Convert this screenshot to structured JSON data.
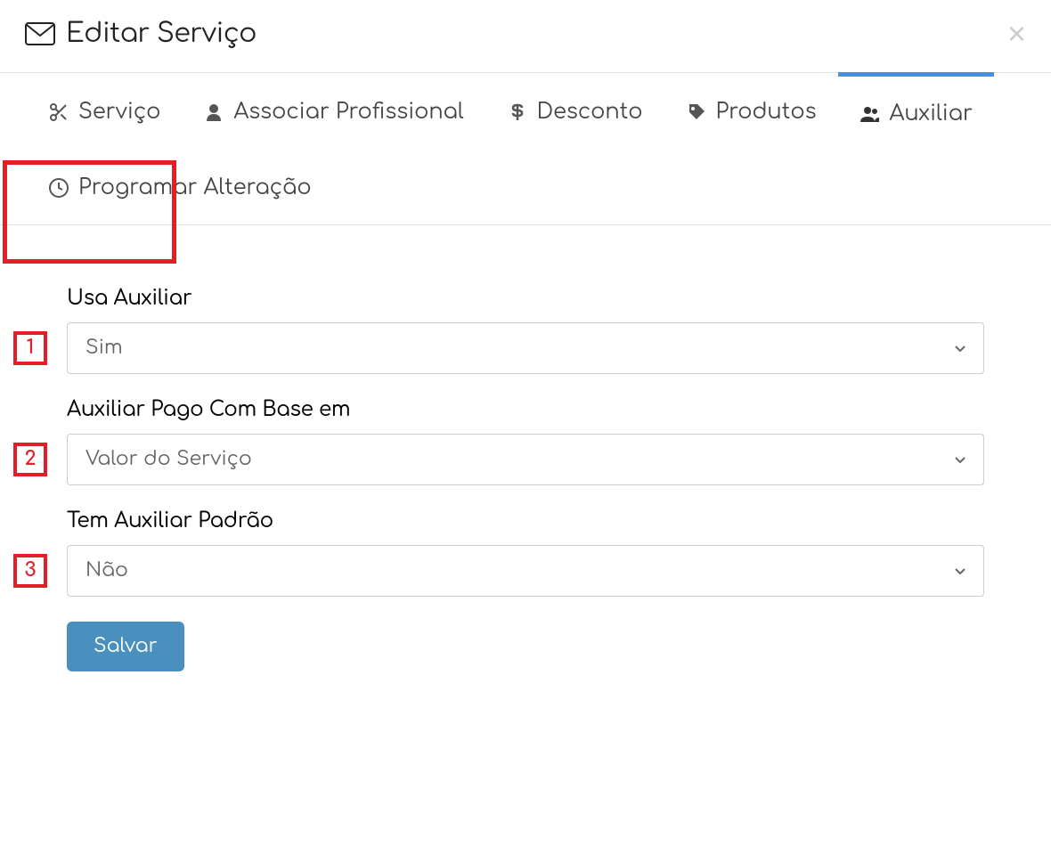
{
  "header": {
    "title": "Editar Serviço"
  },
  "tabs": [
    {
      "label": "Serviço",
      "icon": "scissors"
    },
    {
      "label": "Associar Profissional",
      "icon": "user"
    },
    {
      "label": "Desconto",
      "icon": "dollar"
    },
    {
      "label": "Produtos",
      "icon": "tag"
    },
    {
      "label": "Auxiliar",
      "icon": "users",
      "active": true
    },
    {
      "label": "Programar Alteração",
      "icon": "clock"
    }
  ],
  "form": {
    "usa_auxiliar": {
      "label": "Usa Auxiliar",
      "value": "Sim",
      "badge": "1"
    },
    "pago_com_base": {
      "label": "Auxiliar Pago Com Base em",
      "value": "Valor do Serviço",
      "badge": "2"
    },
    "tem_auxiliar_padrao": {
      "label": "Tem Auxiliar Padrão",
      "value": "Não",
      "badge": "3"
    },
    "save_button": "Salvar"
  },
  "colors": {
    "accent": "#4a90d9",
    "highlight": "#e31e24",
    "button": "#4a90bf"
  }
}
